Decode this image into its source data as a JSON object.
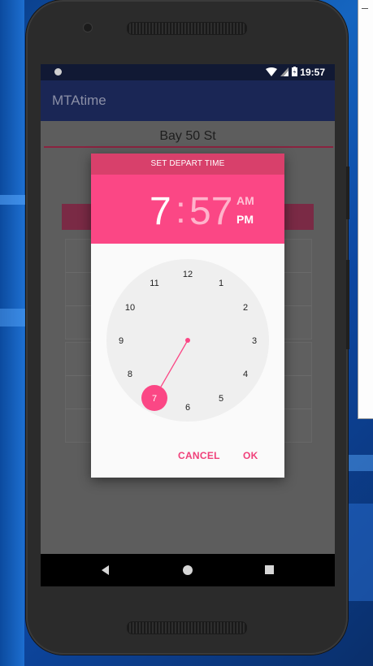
{
  "status_bar": {
    "time": "19:57"
  },
  "app": {
    "title": "MTAtime"
  },
  "content": {
    "station_name": "Bay 50 St"
  },
  "dialog": {
    "title": "SET DEPART TIME",
    "hour": "7",
    "separator": ":",
    "minute": "57",
    "am_label": "AM",
    "pm_label": "PM",
    "selected_period": "PM",
    "clock_numbers": [
      "12",
      "1",
      "2",
      "3",
      "4",
      "5",
      "6",
      "7",
      "8",
      "9",
      "10",
      "11"
    ],
    "selected_hour": "7",
    "cancel_label": "CANCEL",
    "ok_label": "OK"
  },
  "colors": {
    "accent": "#fb4785",
    "title_bar": "#d8406b",
    "app_bar": "#1a2655",
    "status_bar": "#111934"
  },
  "icons": [
    "wifi-icon",
    "signal-icon",
    "battery-icon",
    "nav-back-icon",
    "nav-home-icon",
    "nav-recent-icon"
  ]
}
